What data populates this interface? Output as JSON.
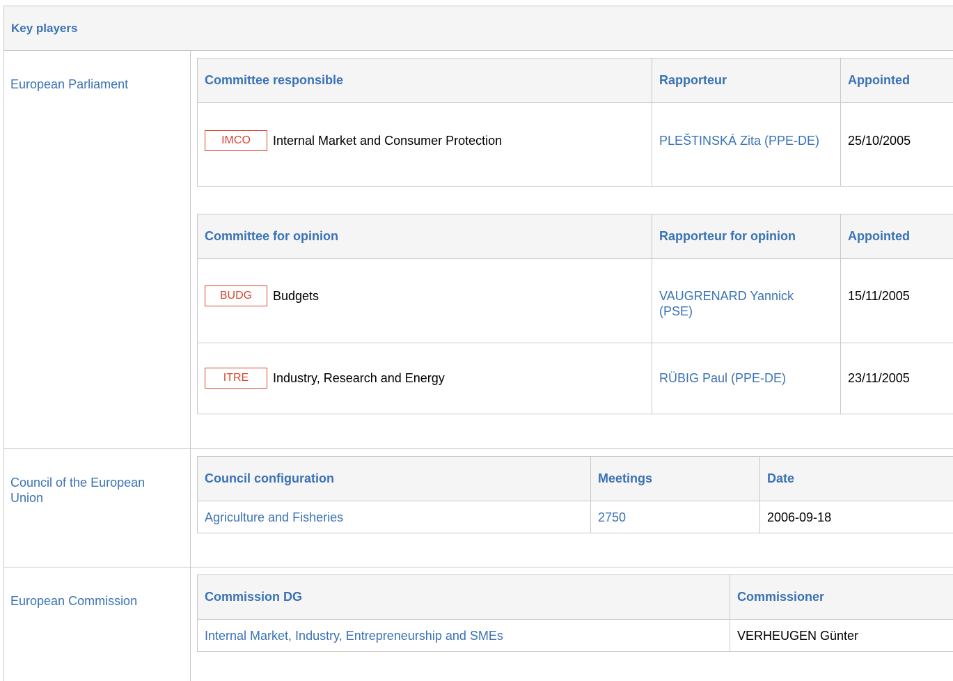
{
  "key_players": {
    "title": "Key players"
  },
  "parliament": {
    "label": "European Parliament",
    "responsible": {
      "headers": {
        "committee": "Committee responsible",
        "rapporteur": "Rapporteur",
        "appointed": "Appointed"
      },
      "rows": [
        {
          "code": "IMCO",
          "name": "Internal Market and Consumer Protection",
          "rapporteur": "PLEŠTINSKÁ Zita (PPE-DE)",
          "appointed": "25/10/2005"
        }
      ]
    },
    "opinion": {
      "headers": {
        "committee": "Committee for opinion",
        "rapporteur": "Rapporteur for opinion",
        "appointed": "Appointed"
      },
      "rows": [
        {
          "code": "BUDG",
          "name": "Budgets",
          "rapporteur": "VAUGRENARD Yannick (PSE)",
          "appointed": "15/11/2005"
        },
        {
          "code": "ITRE",
          "name": "Industry, Research and Energy",
          "rapporteur": "RÜBIG Paul (PPE-DE)",
          "appointed": "23/11/2005"
        }
      ]
    }
  },
  "council": {
    "label": "Council of the European Union",
    "headers": {
      "configuration": "Council configuration",
      "meetings": "Meetings",
      "date": "Date"
    },
    "rows": [
      {
        "configuration": "Agriculture and Fisheries",
        "meetings": "2750",
        "date": "2006-09-18"
      }
    ]
  },
  "commission": {
    "label": "European Commission",
    "headers": {
      "dg": "Commission DG",
      "commissioner": "Commissioner"
    },
    "rows": [
      {
        "dg": "Internal Market, Industry, Entrepreneurship and SMEs",
        "commissioner": "VERHEUGEN Günter"
      }
    ]
  },
  "colors": {
    "link": "#3a72b5",
    "badge": "#d9442f",
    "header_bg": "#f5f5f5",
    "border": "#c8c8c8"
  }
}
